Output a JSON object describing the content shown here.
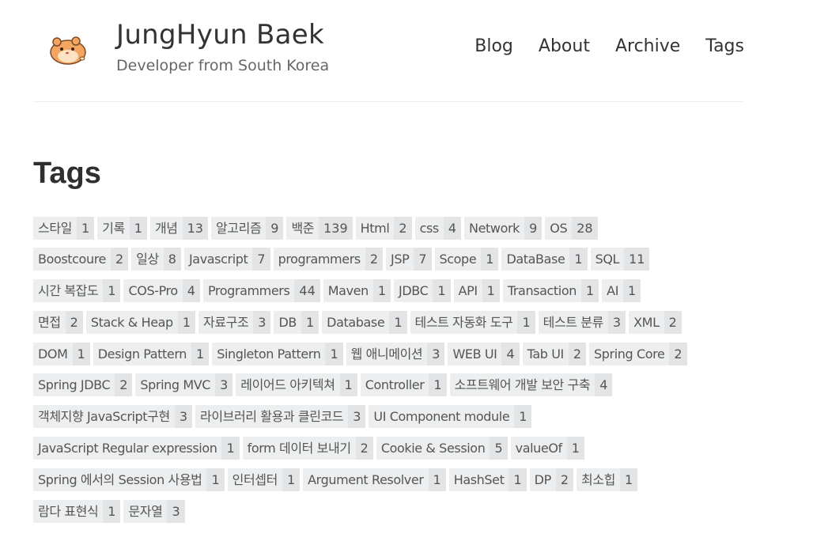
{
  "header": {
    "title": "JungHyun Baek",
    "subtitle": "Developer from South Korea",
    "avatar_icon": "hamster-icon",
    "avatar_colors": {
      "fur": "#f4a661",
      "belly": "#fbe3c4",
      "outline": "#7a4a2a"
    }
  },
  "nav": [
    "Blog",
    "About",
    "Archive",
    "Tags"
  ],
  "page": {
    "title": "Tags"
  },
  "tag_rows": [
    [
      [
        "스타일",
        "1"
      ],
      [
        "기록",
        "1"
      ],
      [
        "개념",
        "13"
      ],
      [
        "알고리즘",
        "9"
      ],
      [
        "백준",
        "139"
      ],
      [
        "Html",
        "2"
      ],
      [
        "css",
        "4"
      ],
      [
        "Network",
        "9"
      ],
      [
        "OS",
        "28"
      ]
    ],
    [
      [
        "Boostcoure",
        "2"
      ],
      [
        "일상",
        "8"
      ],
      [
        "Javascript",
        "7"
      ],
      [
        "programmers",
        "2"
      ],
      [
        "JSP",
        "7"
      ],
      [
        "Scope",
        "1"
      ],
      [
        "DataBase",
        "1"
      ],
      [
        "SQL",
        "11"
      ]
    ],
    [
      [
        "시간 복잡도",
        "1"
      ],
      [
        "COS-Pro",
        "4"
      ],
      [
        "Programmers",
        "44"
      ],
      [
        "Maven",
        "1"
      ],
      [
        "JDBC",
        "1"
      ],
      [
        "API",
        "1"
      ],
      [
        "Transaction",
        "1"
      ],
      [
        "AI",
        "1"
      ]
    ],
    [
      [
        "면접",
        "2"
      ],
      [
        "Stack & Heap",
        "1"
      ],
      [
        "자료구조",
        "3"
      ],
      [
        "DB",
        "1"
      ],
      [
        "Database",
        "1"
      ],
      [
        "테스트 자동화 도구",
        "1"
      ],
      [
        "테스트 분류",
        "3"
      ],
      [
        "XML",
        "2"
      ]
    ],
    [
      [
        "DOM",
        "1"
      ],
      [
        "Design Pattern",
        "1"
      ],
      [
        "Singleton Pattern",
        "1"
      ],
      [
        "웹 애니메이션",
        "3"
      ],
      [
        "WEB UI",
        "4"
      ],
      [
        "Tab UI",
        "2"
      ],
      [
        "Spring Core",
        "2"
      ]
    ],
    [
      [
        "Spring JDBC",
        "2"
      ],
      [
        "Spring MVC",
        "3"
      ],
      [
        "레이어드 아키텍쳐",
        "1"
      ],
      [
        "Controller",
        "1"
      ],
      [
        "소프트웨어 개발 보안 구축",
        "4"
      ]
    ],
    [
      [
        "객체지향 JavaScript구현",
        "3"
      ],
      [
        "라이브러리 활용과 클린코드",
        "3"
      ],
      [
        "UI Component module",
        "1"
      ]
    ],
    [
      [
        "JavaScript Regular expression",
        "1"
      ],
      [
        "form 데이터 보내기",
        "2"
      ],
      [
        "Cookie & Session",
        "5"
      ],
      [
        "valueOf",
        "1"
      ]
    ],
    [
      [
        "Spring 에서의 Session 사용법",
        "1"
      ],
      [
        "인터셉터",
        "1"
      ],
      [
        "Argument Resolver",
        "1"
      ],
      [
        "HashSet",
        "1"
      ],
      [
        "DP",
        "2"
      ],
      [
        "최소힙",
        "1"
      ]
    ],
    [
      [
        "람다 표현식",
        "1"
      ],
      [
        "문자열",
        "3"
      ]
    ]
  ]
}
